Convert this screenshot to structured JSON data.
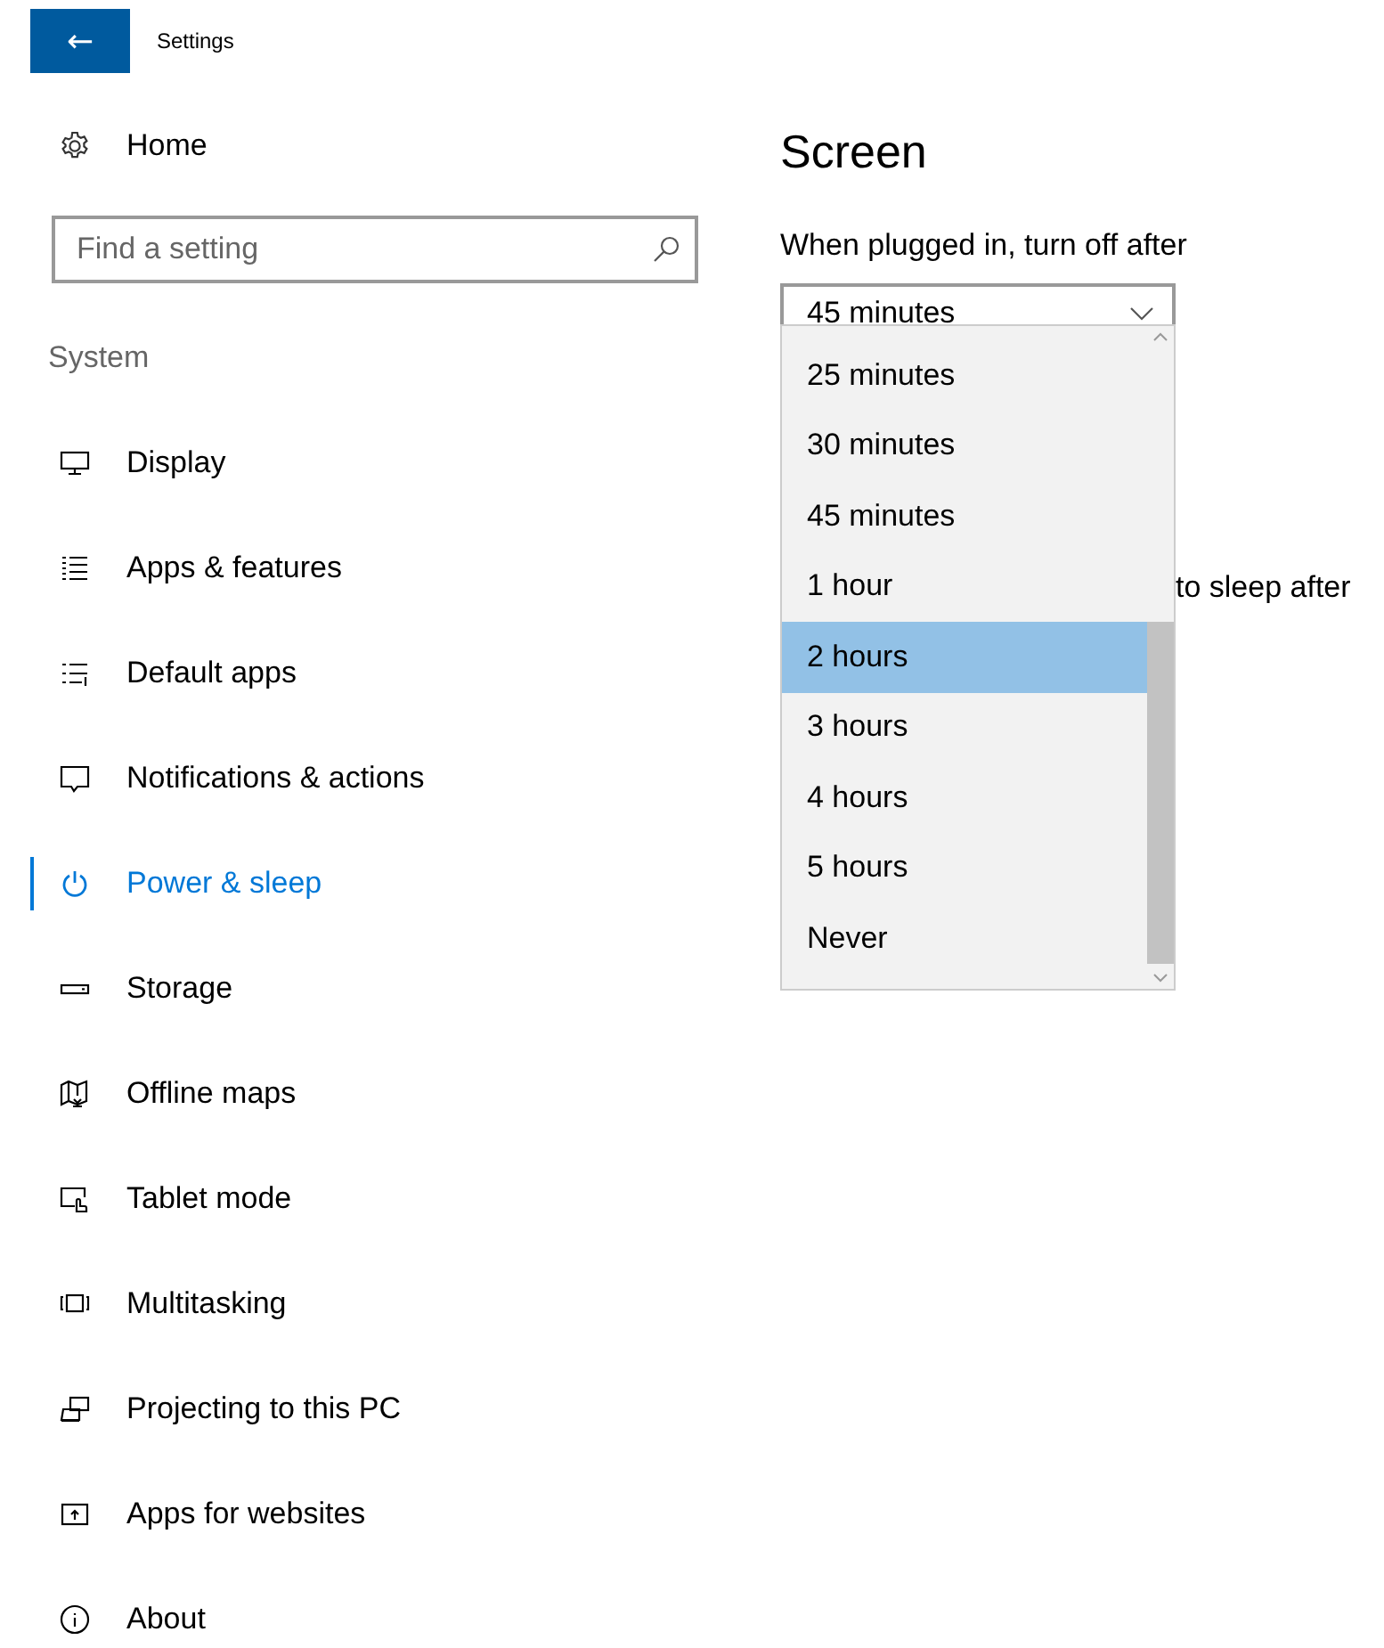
{
  "window": {
    "title": "Settings",
    "back": "←"
  },
  "sidebar": {
    "home": "Home",
    "search": {
      "placeholder": "Find a setting"
    },
    "section": "System",
    "items": [
      {
        "label": "Display",
        "selected": false
      },
      {
        "label": "Apps & features",
        "selected": false
      },
      {
        "label": "Default apps",
        "selected": false
      },
      {
        "label": "Notifications & actions",
        "selected": false
      },
      {
        "label": "Power & sleep",
        "selected": true
      },
      {
        "label": "Storage",
        "selected": false
      },
      {
        "label": "Offline maps",
        "selected": false
      },
      {
        "label": "Tablet mode",
        "selected": false
      },
      {
        "label": "Multitasking",
        "selected": false
      },
      {
        "label": "Projecting to this PC",
        "selected": false
      },
      {
        "label": "Apps for websites",
        "selected": false
      },
      {
        "label": "About",
        "selected": false
      }
    ]
  },
  "content": {
    "heading": "Screen",
    "label": "When plugged in, turn off after",
    "dropdown": {
      "value": "45 minutes",
      "expanded": true,
      "options": [
        {
          "label": "25 minutes",
          "highlighted": false
        },
        {
          "label": "30 minutes",
          "highlighted": false
        },
        {
          "label": "45 minutes",
          "highlighted": false
        },
        {
          "label": "1 hour",
          "highlighted": false
        },
        {
          "label": "2 hours",
          "highlighted": true
        },
        {
          "label": "3 hours",
          "highlighted": false
        },
        {
          "label": "4 hours",
          "highlighted": false
        },
        {
          "label": "5 hours",
          "highlighted": false
        },
        {
          "label": "Never",
          "highlighted": false
        }
      ]
    },
    "partial_label": "to sleep after"
  }
}
